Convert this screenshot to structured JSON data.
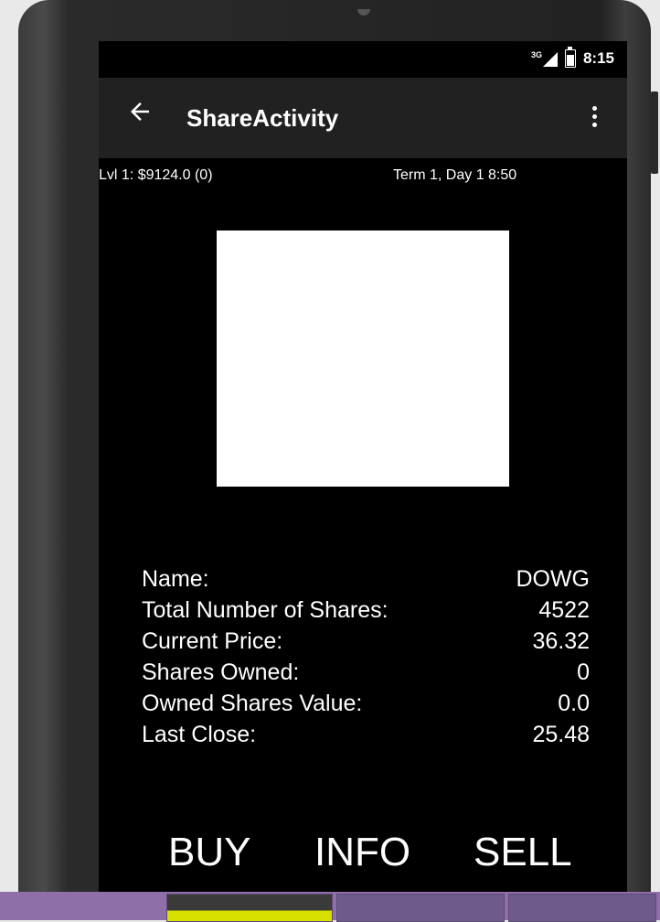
{
  "status_bar": {
    "network_label": "3G",
    "time": "8:15"
  },
  "app_bar": {
    "title": "ShareActivity",
    "back_icon": "arrow-left-icon",
    "menu_icon": "overflow-menu-icon"
  },
  "info_line": {
    "left": "Lvl 1: $9124.0 (0)",
    "right": "Term 1, Day 1  8:50"
  },
  "share_details": {
    "rows": [
      {
        "label": "Name:",
        "value": "DOWG"
      },
      {
        "label": "Total Number of Shares:",
        "value": "4522"
      },
      {
        "label": "Current Price:",
        "value": "36.32"
      },
      {
        "label": "Shares Owned:",
        "value": "0"
      },
      {
        "label": "Owned Shares Value:",
        "value": "0.0"
      },
      {
        "label": "Last Close:",
        "value": "25.48"
      }
    ]
  },
  "actions": {
    "buy": "BUY",
    "info": "INFO",
    "sell": "SELL"
  },
  "colors": {
    "screen_bg": "#000000",
    "app_bar_bg": "#212121",
    "text": "#ffffff",
    "chart_area": "#ffffff"
  }
}
